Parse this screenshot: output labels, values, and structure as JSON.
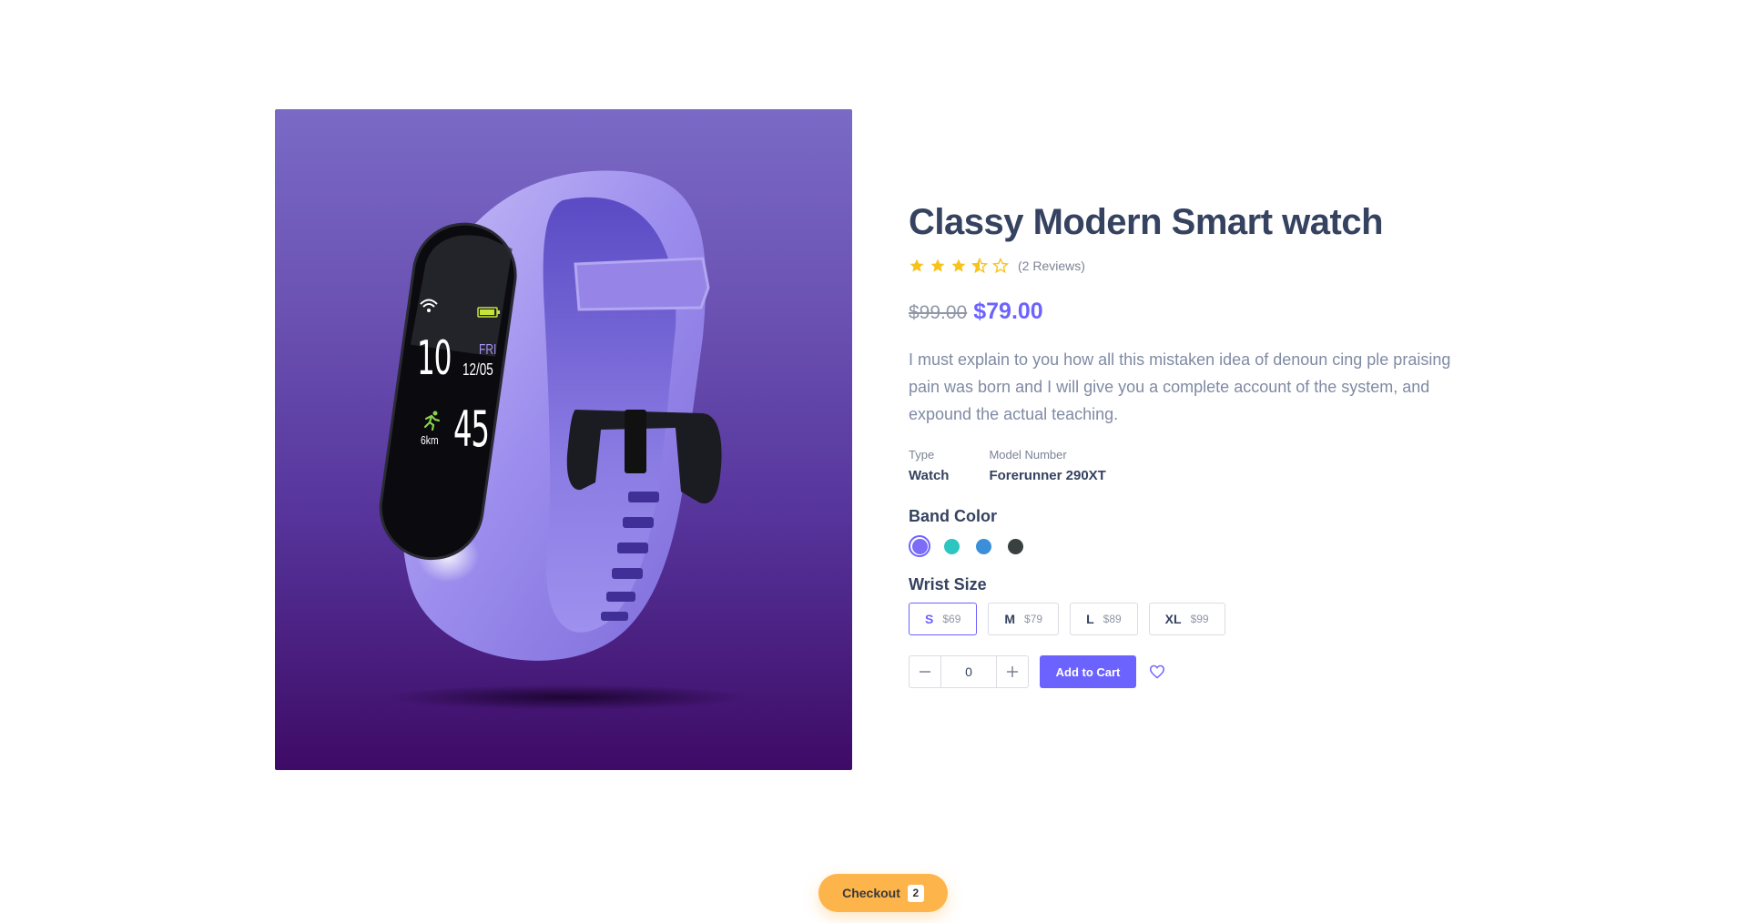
{
  "product": {
    "title": "Classy Modern Smart watch",
    "rating": 3.5,
    "rating_max": 5,
    "reviews_text": "(2 Reviews)",
    "old_price": "$99.00",
    "price": "$79.00",
    "description": "I must explain to you how all this mistaken idea of denoun cing ple praising pain was born and I will give you a complete account of the system, and expound the actual teaching.",
    "specs": [
      {
        "label": "Type",
        "value": "Watch"
      },
      {
        "label": "Model Number",
        "value": "Forerunner 290XT"
      }
    ],
    "band_color_heading": "Band Color",
    "band_colors": [
      {
        "name": "purple",
        "hex": "#7d6cf5",
        "selected": true
      },
      {
        "name": "teal",
        "hex": "#2dc5bf",
        "selected": false
      },
      {
        "name": "blue",
        "hex": "#3b8fd8",
        "selected": false
      },
      {
        "name": "charcoal",
        "hex": "#3a403f",
        "selected": false
      }
    ],
    "wrist_size_heading": "Wrist Size",
    "sizes": [
      {
        "label": "S",
        "price": "$69",
        "selected": true
      },
      {
        "label": "M",
        "price": "$79",
        "selected": false
      },
      {
        "label": "L",
        "price": "$89",
        "selected": false
      },
      {
        "label": "XL",
        "price": "$99",
        "selected": false
      }
    ],
    "quantity": "0",
    "add_to_cart_label": "Add to Cart"
  },
  "watch_screen": {
    "hour": "10",
    "day": "FRI",
    "date": "12/05",
    "steps": "45",
    "distance": "6km"
  },
  "checkout": {
    "label": "Checkout",
    "count": "2"
  },
  "colors": {
    "accent": "#6c63ff",
    "star": "#f7c21a",
    "checkout": "#fdb44b",
    "heading": "#354260"
  },
  "icons": [
    "star-icon",
    "half-star-icon",
    "minus-icon",
    "plus-icon",
    "heart-icon",
    "wifi-icon",
    "battery-icon",
    "runner-icon"
  ]
}
